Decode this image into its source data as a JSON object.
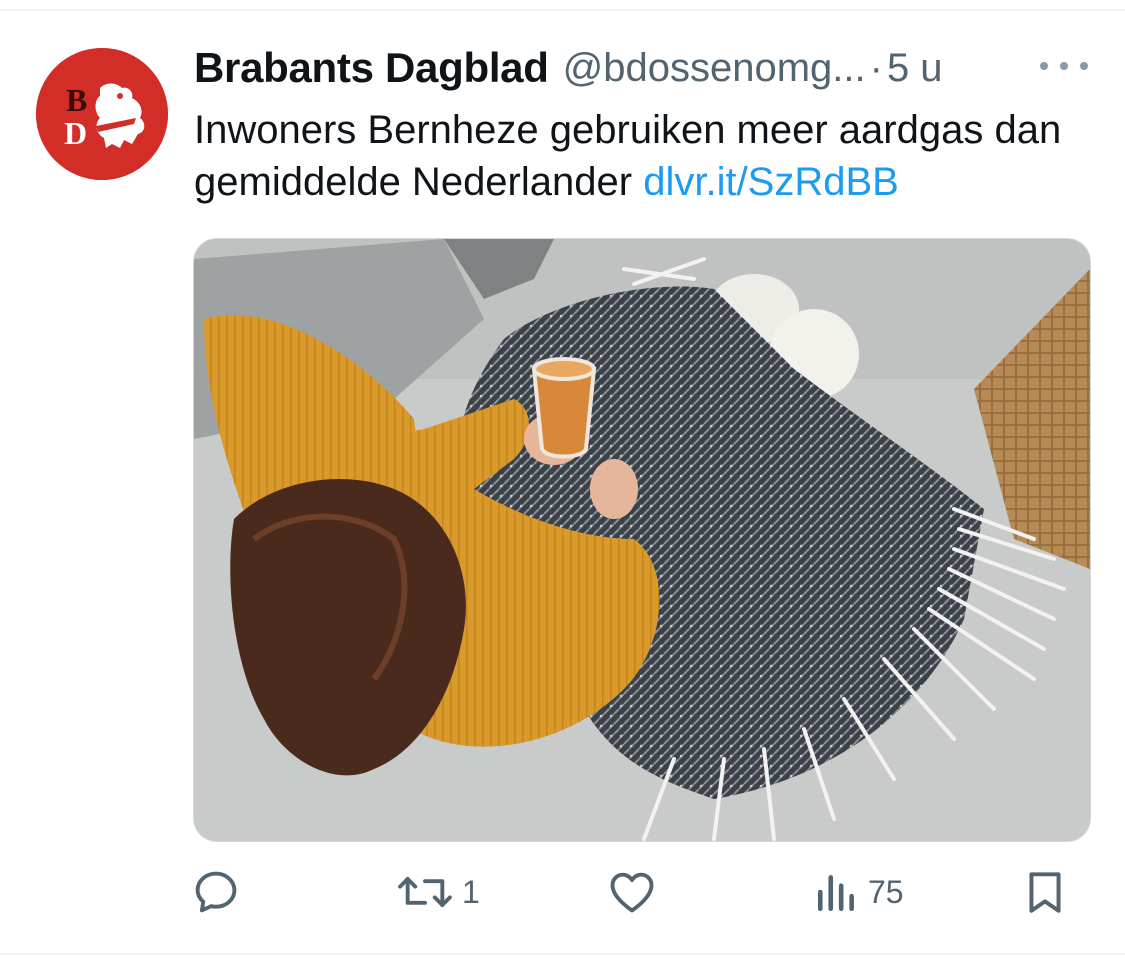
{
  "tweet": {
    "display_name": "Brabants Dagblad",
    "handle": "@bdossenomg...",
    "separator": "·",
    "time": "5 u",
    "text": "Inwoners Bernheze gebruiken meer aardgas dan gemiddelde Nederlander",
    "link": "dlvr.it/SzRdBB",
    "avatar": {
      "icon": "bd-lion-logo-icon",
      "color": "#d32d27",
      "logo_text": "BD"
    },
    "media": {
      "description_icon": "woman-on-sofa-photo"
    }
  },
  "actions": {
    "reply": {
      "icon": "reply-icon",
      "count": ""
    },
    "retweet": {
      "icon": "retweet-icon",
      "count": "1"
    },
    "like": {
      "icon": "heart-icon",
      "count": ""
    },
    "views": {
      "icon": "views-icon",
      "count": "75"
    },
    "bookmark": {
      "icon": "bookmark-icon",
      "count": ""
    }
  },
  "colors": {
    "text": "#0f1419",
    "secondary": "#536471",
    "link": "#1d9bf0",
    "brand_red": "#d32d27"
  }
}
